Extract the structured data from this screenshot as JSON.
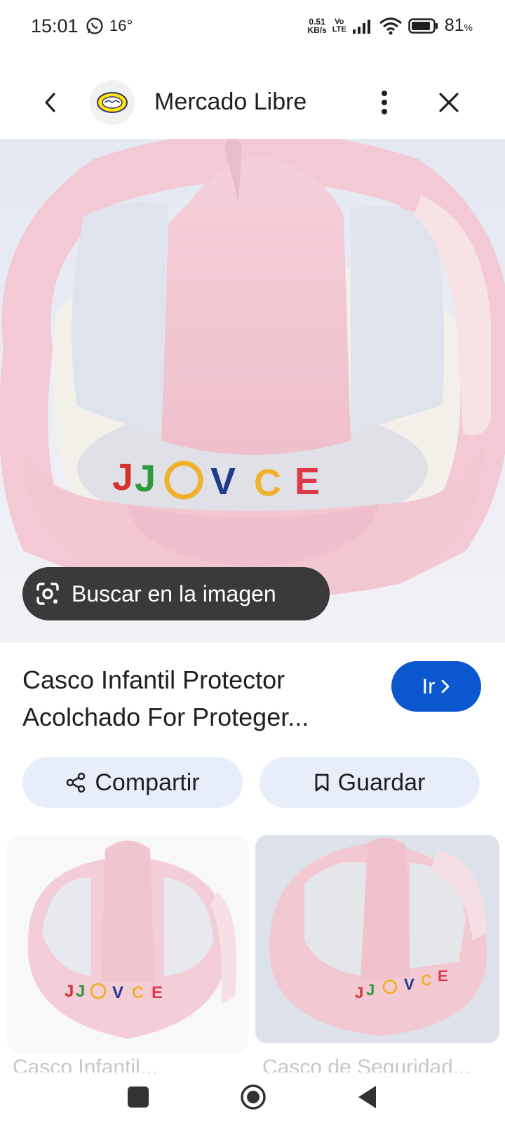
{
  "status_bar": {
    "time": "15:01",
    "notification_icon": "whatsapp-icon",
    "temperature": "16°",
    "net_speed_value": "0.51",
    "net_speed_unit": "KB/s",
    "volte_top": "Vo",
    "volte_bottom": "LTE",
    "battery_percent": "81",
    "battery_unit": "%"
  },
  "header": {
    "site_title": "Mercado Libre",
    "logo": "mercado-libre-handshake-logo"
  },
  "main_image": {
    "lens_label": "Buscar en la imagen",
    "embroidery": "JJOVCE"
  },
  "result": {
    "title_line1": "Casco Infantil Protector",
    "title_line2": "Acolchado For Proteger...",
    "go_label": "Ir"
  },
  "actions": {
    "share_label": "Compartir",
    "save_label": "Guardar"
  },
  "related": [
    {
      "caption": "Casco Infantil..."
    },
    {
      "caption": "Casco de Seguridad..."
    }
  ],
  "colors": {
    "accent": "#0b57d0",
    "chip_bg": "#e8eef9",
    "helmet_pink": "#f2c9d4",
    "lens_chip_bg": "#3a3a3a"
  }
}
